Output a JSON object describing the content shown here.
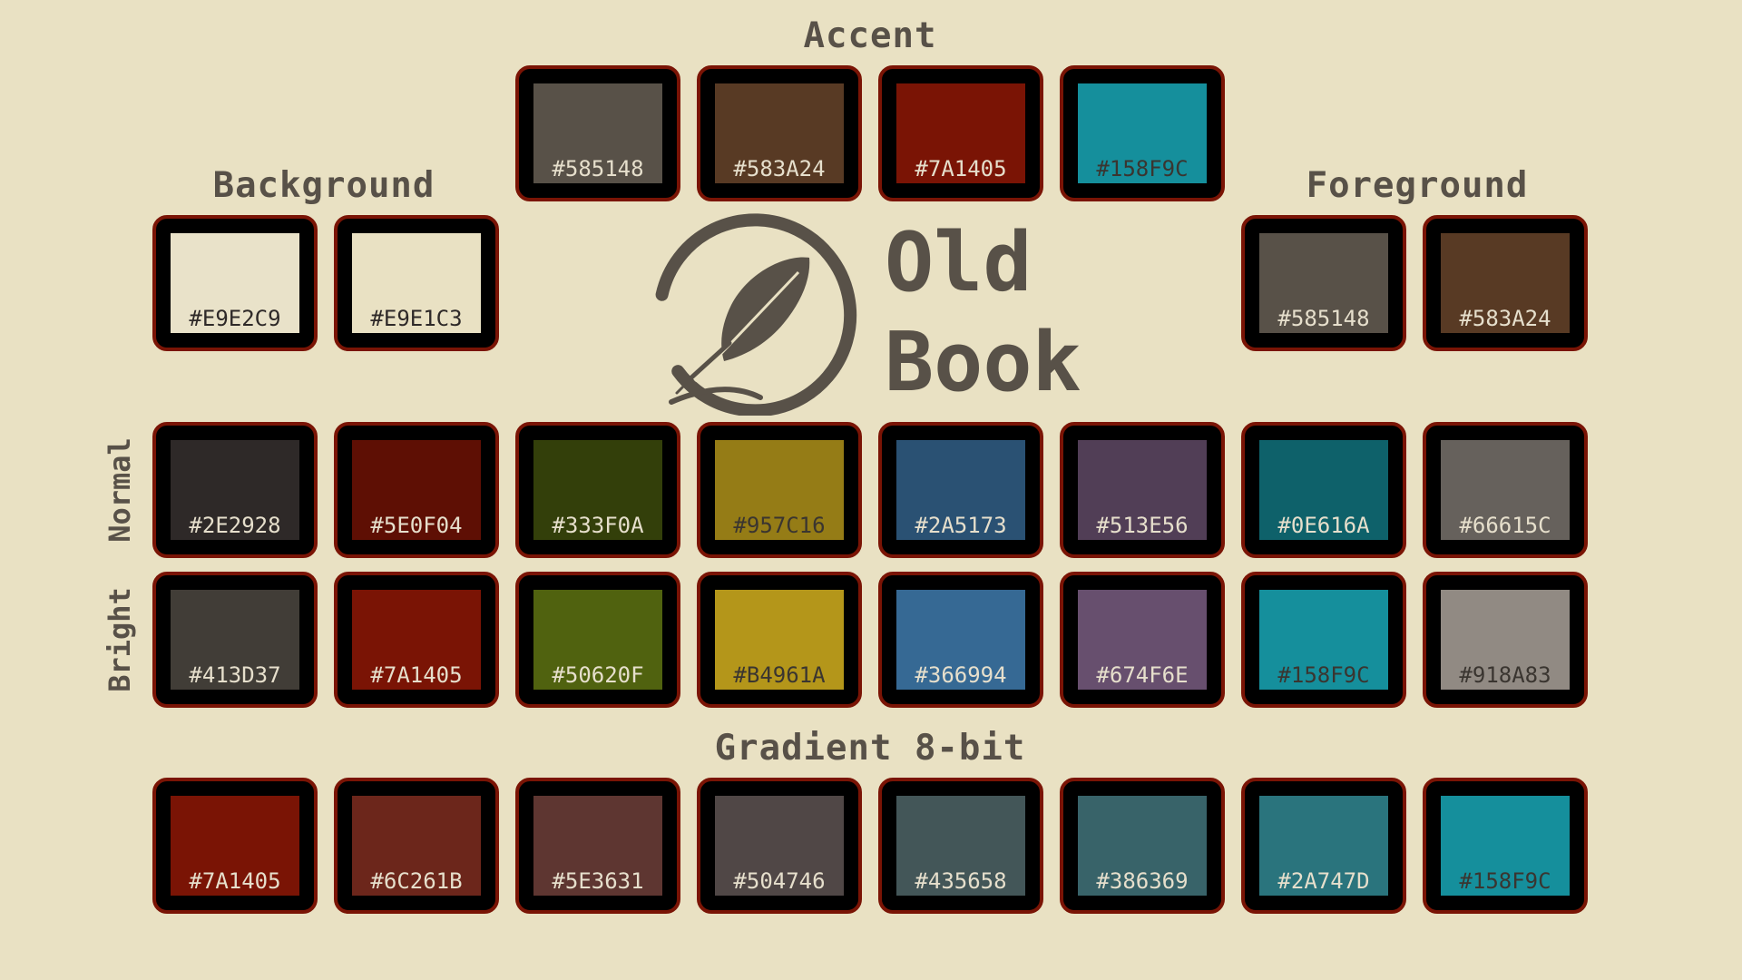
{
  "headings": {
    "accent": "Accent",
    "background": "Background",
    "foreground": "Foreground",
    "normal": "Normal",
    "bright": "Bright",
    "gradient": "Gradient 8-bit"
  },
  "title": {
    "line1": "Old",
    "line2": "Book"
  },
  "logo": {
    "icon": "quill-feather-icon"
  },
  "colors": {
    "frame_border": "#7A1405",
    "frame_fill": "#000000",
    "text": "#585148",
    "page_background": "#E9E1C3"
  },
  "accent": [
    {
      "hex": "#585148"
    },
    {
      "hex": "#583A24"
    },
    {
      "hex": "#7A1405"
    },
    {
      "hex": "#158F9C"
    }
  ],
  "background": [
    {
      "hex": "#E9E2C9"
    },
    {
      "hex": "#E9E1C3"
    }
  ],
  "foreground": [
    {
      "hex": "#585148"
    },
    {
      "hex": "#583A24"
    }
  ],
  "normal": [
    {
      "hex": "#2E2928"
    },
    {
      "hex": "#5E0F04"
    },
    {
      "hex": "#333F0A"
    },
    {
      "hex": "#957C16"
    },
    {
      "hex": "#2A5173"
    },
    {
      "hex": "#513E56"
    },
    {
      "hex": "#0E616A"
    },
    {
      "hex": "#66615C"
    }
  ],
  "bright": [
    {
      "hex": "#413D37"
    },
    {
      "hex": "#7A1405"
    },
    {
      "hex": "#50620F"
    },
    {
      "hex": "#B4961A"
    },
    {
      "hex": "#366994"
    },
    {
      "hex": "#674F6E"
    },
    {
      "hex": "#158F9C"
    },
    {
      "hex": "#918A83"
    }
  ],
  "gradient": [
    {
      "hex": "#7A1405"
    },
    {
      "hex": "#6C261B"
    },
    {
      "hex": "#5E3631"
    },
    {
      "hex": "#504746"
    },
    {
      "hex": "#435658"
    },
    {
      "hex": "#386369"
    },
    {
      "hex": "#2A747D"
    },
    {
      "hex": "#158F9C"
    }
  ]
}
